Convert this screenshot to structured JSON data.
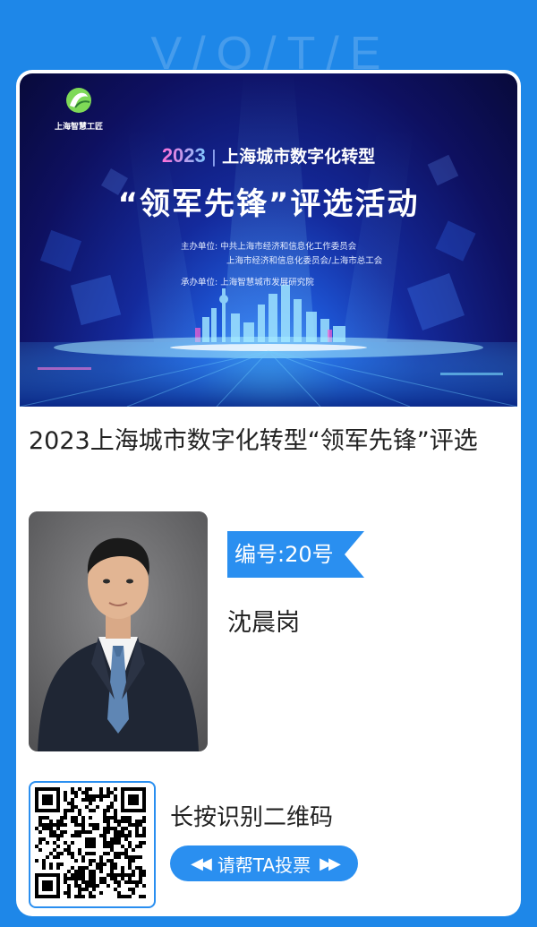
{
  "watermark": [
    "V",
    "/",
    "O",
    "/",
    "T",
    "/",
    "E"
  ],
  "banner": {
    "logo_text": "上海智慧工匠",
    "year": "2023",
    "subtitle": "上海城市数字化转型",
    "headline": "“领军先锋”评选活动",
    "org_lines": [
      "主办单位:  中共上海市经济和信息化工作委员会",
      "                 上海市经济和信息化委员会/上海市总工会",
      "承办单位:  上海智慧城市发展研究院"
    ]
  },
  "title": "2023上海城市数字化转型“领军先锋”评选",
  "candidate": {
    "number": "编号:20号",
    "name": "沈晨岗"
  },
  "qr": {
    "label": "长按识别二维码",
    "vote_button": "请帮TA投票",
    "left_arrow": "◀◀",
    "right_arrow": "▶▶"
  },
  "colors": {
    "background": "#1e87e8",
    "accent": "#2a8ff0"
  }
}
